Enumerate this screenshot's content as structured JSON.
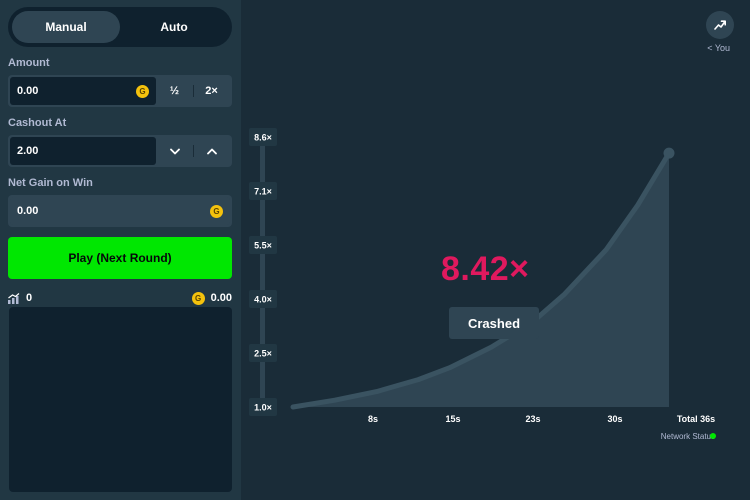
{
  "mode_toggle": {
    "manual_label": "Manual",
    "auto_label": "Auto"
  },
  "amount": {
    "label": "Amount",
    "value": "0.00",
    "currency_symbol": "G",
    "half_label": "½",
    "double_label": "2×"
  },
  "cashout": {
    "label": "Cashout At",
    "value": "2.00",
    "decrease_icon": "chevron-down-icon",
    "increase_icon": "chevron-up-icon"
  },
  "net_gain": {
    "label": "Net Gain on Win",
    "value": "0.00",
    "currency_symbol": "G"
  },
  "play_button": {
    "label": "Play (Next Round)"
  },
  "stats": {
    "players": "0",
    "total_bet": "0.00",
    "currency_symbol": "G"
  },
  "game": {
    "crash_multiplier": "8.42×",
    "status": "Crashed",
    "you_label": "< You",
    "network_status_label": "Network Status",
    "network_status_color": "#00e701"
  },
  "chart_data": {
    "type": "area",
    "y_tick_labels": [
      "8.6×",
      "7.1×",
      "5.5×",
      "4.0×",
      "2.5×",
      "1.0×"
    ],
    "x_tick_labels": [
      "8s",
      "15s",
      "23s",
      "30s",
      "Total 36s"
    ],
    "series": [
      {
        "x": [
          0,
          4,
          8,
          12,
          15,
          19,
          23,
          26,
          30,
          33,
          36
        ],
        "y": [
          1.0,
          1.2,
          1.45,
          1.8,
          2.15,
          2.75,
          3.5,
          4.3,
          5.6,
          6.9,
          8.42
        ]
      }
    ],
    "xlim": [
      0,
      36
    ],
    "ylim": [
      1.0,
      8.6
    ],
    "colors": {
      "area": "#2f4553",
      "line": "#3a5361",
      "accent": "#e0195e"
    }
  }
}
